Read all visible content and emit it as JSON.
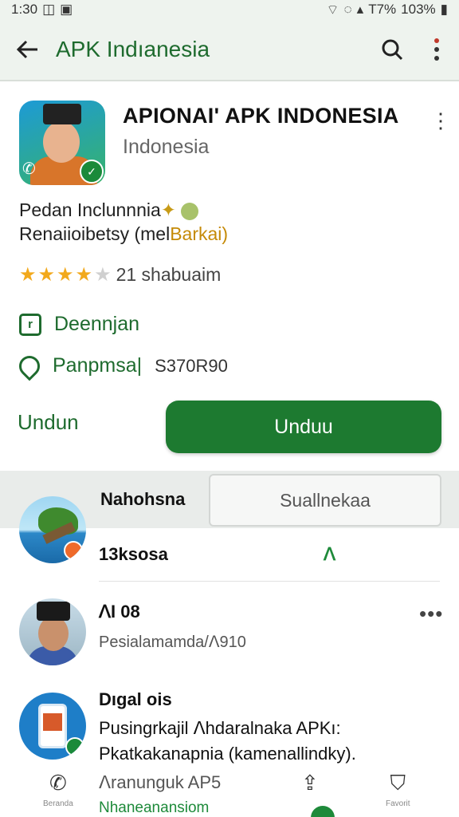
{
  "status_bar": {
    "time": "1:30",
    "battery": "T7%",
    "battery2": "103%"
  },
  "app_bar": {
    "title": "APK Indıanesia"
  },
  "app": {
    "title": "APIONAI' APK INDONESIA",
    "subtitle": "Indonesia",
    "desc_line1": "Pedan Inclunnnia",
    "desc_line1_emoji": "✦",
    "desc_line2_prefix": "Renaiioibetsy (mel",
    "desc_line2_highlight": "Barkai)",
    "rating_value": 4.5,
    "rating_text": "21 shabuaim",
    "info1": "Deennjan",
    "info2_label": "Panpmsa|",
    "info2_value": "S370R90",
    "secondary_btn": "Undun",
    "primary_btn": "Unduu"
  },
  "tabs": {
    "left": "Nahohsna",
    "right": "Suallnekaa"
  },
  "list": [
    {
      "title": "13ksosa",
      "tag": "ᐱ"
    },
    {
      "title": "ᐱI 08",
      "sub": "Pesialamamda/ᐱ910",
      "more": "•••"
    },
    {
      "title": "Dıgal ois",
      "body1": "Pusingrkajil ᐱhdaralnaka APKı:",
      "body2": "Pkatkakanapnia (kamenallindky)."
    }
  ],
  "bottom_nav": {
    "label1": "Beranda",
    "text1": "ᐱranunguk AP5",
    "text2": "Nhaneanansiom",
    "label2": "Favorit"
  },
  "colors": {
    "accent": "#1d7a30",
    "appbar": "#eef3ee",
    "star": "#f2a91c"
  }
}
